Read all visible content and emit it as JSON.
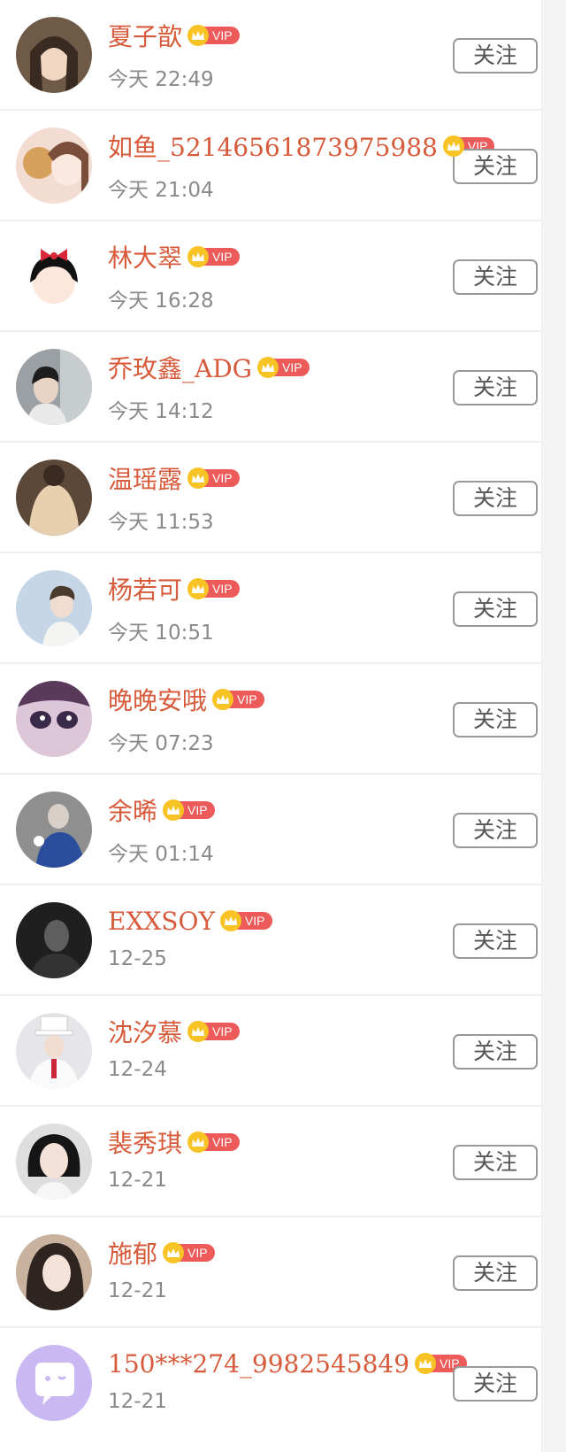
{
  "follow_label": "关注",
  "vip_label": "VIP",
  "users": [
    {
      "name": "夏子歆",
      "time": "今天 22:49"
    },
    {
      "name": "如鱼_52146561873975988",
      "time": "今天 21:04"
    },
    {
      "name": "林大翠",
      "time": "今天 16:28"
    },
    {
      "name": "乔玫鑫_ADG",
      "time": "今天 14:12"
    },
    {
      "name": "温瑶露",
      "time": "今天 11:53"
    },
    {
      "name": "杨若可",
      "time": "今天 10:51"
    },
    {
      "name": "晚晚安哦",
      "time": "今天 07:23"
    },
    {
      "name": "余晞",
      "time": "今天 01:14"
    },
    {
      "name": "EXXSOY",
      "time": "12-25"
    },
    {
      "name": "沈汐慕",
      "time": "12-24"
    },
    {
      "name": "裴秀琪",
      "time": "12-21"
    },
    {
      "name": "施郁",
      "time": "12-21"
    },
    {
      "name": "150***274_9982545849",
      "time": "12-21"
    }
  ],
  "colors": {
    "name": "#d75a3a",
    "vip_badge": "#ec5a5a",
    "crown": "#f7c325",
    "time": "#8a8a8a"
  }
}
